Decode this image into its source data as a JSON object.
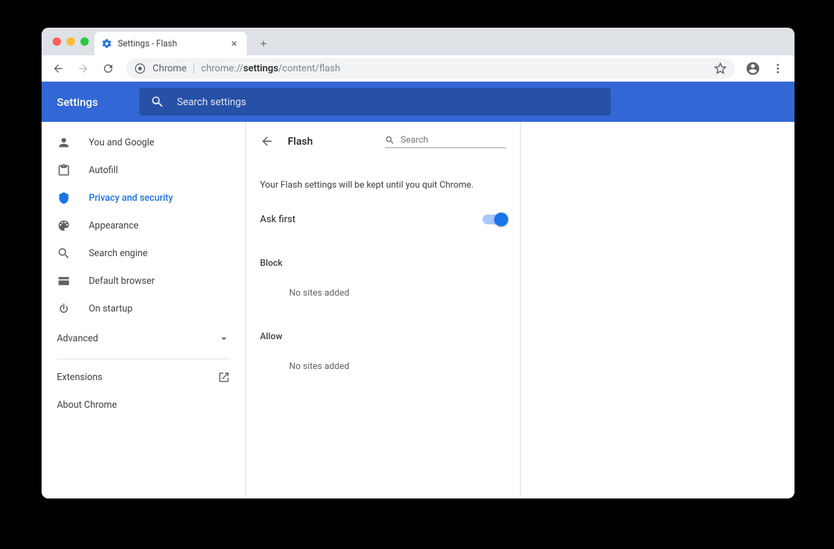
{
  "tab": {
    "title": "Settings - Flash"
  },
  "omnibox": {
    "scheme_label": "Chrome",
    "url_prefix": "chrome://",
    "url_bold": "settings",
    "url_suffix": "/content/flash"
  },
  "header": {
    "title": "Settings",
    "search_placeholder": "Search settings"
  },
  "sidebar": {
    "items": [
      {
        "label": "You and Google"
      },
      {
        "label": "Autofill"
      },
      {
        "label": "Privacy and security"
      },
      {
        "label": "Appearance"
      },
      {
        "label": "Search engine"
      },
      {
        "label": "Default browser"
      },
      {
        "label": "On startup"
      }
    ],
    "advanced_label": "Advanced",
    "extensions_label": "Extensions",
    "about_label": "About Chrome"
  },
  "page": {
    "title": "Flash",
    "search_placeholder": "Search",
    "note": "Your Flash settings will be kept until you quit Chrome.",
    "ask_first_label": "Ask first",
    "block_label": "Block",
    "block_empty": "No sites added",
    "allow_label": "Allow",
    "allow_empty": "No sites added"
  }
}
